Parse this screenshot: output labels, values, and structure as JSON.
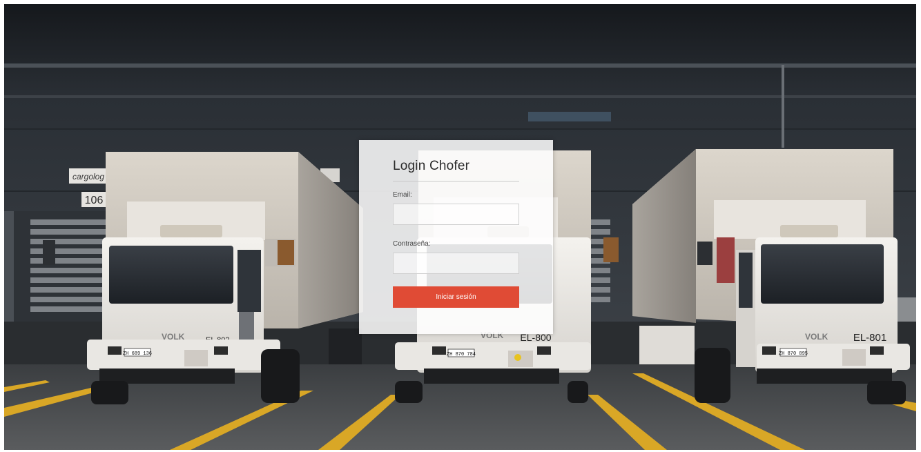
{
  "login": {
    "title": "Login Chofer",
    "email_label": "Email:",
    "email_value": "",
    "password_label": "Contraseña:",
    "password_value": "",
    "submit_label": "Iniciar sesión"
  },
  "background": {
    "depot_sign": "cargolog",
    "dock_number": "106",
    "trucks": [
      {
        "unit": "EL 802",
        "plate": "ZH 689 136",
        "brand": "VOLK"
      },
      {
        "unit": "EL-800",
        "plate": "ZH 870 784",
        "brand": "VOLK"
      },
      {
        "unit": "EL-801",
        "plate": "ZH 870 895",
        "brand": "VOLK"
      }
    ]
  },
  "colors": {
    "button": "#e04b35",
    "road_line": "#d9a726",
    "card": "#ffffff"
  }
}
